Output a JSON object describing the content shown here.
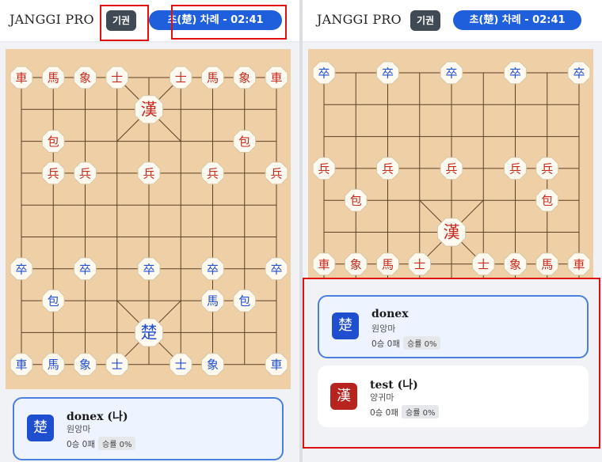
{
  "colors": {
    "board": "#efcfa5",
    "line": "#5c4026",
    "piece_fill": "#fffaf0",
    "cho_blue": "#1f4fcf",
    "han_red": "#c8281e",
    "turn_badge": "#1f5fdc",
    "highlight": "#e01010"
  },
  "header": {
    "title": "JANGGI PRO",
    "give_up_label": "기권",
    "turn_label": "초(楚) 차례 - 02:41"
  },
  "left_board": {
    "pieces": [
      {
        "ch": "車",
        "side": "red",
        "col": 0,
        "row": 0
      },
      {
        "ch": "馬",
        "side": "red",
        "col": 1,
        "row": 0
      },
      {
        "ch": "象",
        "side": "red",
        "col": 2,
        "row": 0
      },
      {
        "ch": "士",
        "side": "red",
        "col": 3,
        "row": 0
      },
      {
        "ch": "士",
        "side": "red",
        "col": 5,
        "row": 0
      },
      {
        "ch": "馬",
        "side": "red",
        "col": 6,
        "row": 0
      },
      {
        "ch": "象",
        "side": "red",
        "col": 7,
        "row": 0
      },
      {
        "ch": "車",
        "side": "red",
        "col": 8,
        "row": 0
      },
      {
        "ch": "漢",
        "side": "red",
        "col": 4,
        "row": 1,
        "king": true
      },
      {
        "ch": "包",
        "side": "red",
        "col": 1,
        "row": 2
      },
      {
        "ch": "包",
        "side": "red",
        "col": 7,
        "row": 2
      },
      {
        "ch": "兵",
        "side": "red",
        "col": 1,
        "row": 3
      },
      {
        "ch": "兵",
        "side": "red",
        "col": 2,
        "row": 3
      },
      {
        "ch": "兵",
        "side": "red",
        "col": 4,
        "row": 3
      },
      {
        "ch": "兵",
        "side": "red",
        "col": 6,
        "row": 3
      },
      {
        "ch": "兵",
        "side": "red",
        "col": 8,
        "row": 3
      },
      {
        "ch": "卒",
        "side": "blue",
        "col": 0,
        "row": 6
      },
      {
        "ch": "卒",
        "side": "blue",
        "col": 2,
        "row": 6
      },
      {
        "ch": "卒",
        "side": "blue",
        "col": 4,
        "row": 6
      },
      {
        "ch": "卒",
        "side": "blue",
        "col": 6,
        "row": 6
      },
      {
        "ch": "卒",
        "side": "blue",
        "col": 8,
        "row": 6
      },
      {
        "ch": "包",
        "side": "blue",
        "col": 1,
        "row": 7
      },
      {
        "ch": "馬",
        "side": "blue",
        "col": 6,
        "row": 7
      },
      {
        "ch": "包",
        "side": "blue",
        "col": 7,
        "row": 7
      },
      {
        "ch": "楚",
        "side": "blue",
        "col": 4,
        "row": 8,
        "king": true
      },
      {
        "ch": "車",
        "side": "blue",
        "col": 0,
        "row": 9
      },
      {
        "ch": "馬",
        "side": "blue",
        "col": 1,
        "row": 9
      },
      {
        "ch": "象",
        "side": "blue",
        "col": 2,
        "row": 9
      },
      {
        "ch": "士",
        "side": "blue",
        "col": 3,
        "row": 9
      },
      {
        "ch": "士",
        "side": "blue",
        "col": 5,
        "row": 9
      },
      {
        "ch": "象",
        "side": "blue",
        "col": 6,
        "row": 9
      },
      {
        "ch": "車",
        "side": "blue",
        "col": 8,
        "row": 9
      }
    ]
  },
  "right_board": {
    "pieces": [
      {
        "ch": "卒",
        "side": "blue",
        "col": 0,
        "row": 0
      },
      {
        "ch": "卒",
        "side": "blue",
        "col": 2,
        "row": 0
      },
      {
        "ch": "卒",
        "side": "blue",
        "col": 4,
        "row": 0
      },
      {
        "ch": "卒",
        "side": "blue",
        "col": 6,
        "row": 0
      },
      {
        "ch": "卒",
        "side": "blue",
        "col": 8,
        "row": 0
      },
      {
        "ch": "兵",
        "side": "red",
        "col": 0,
        "row": 3
      },
      {
        "ch": "兵",
        "side": "red",
        "col": 2,
        "row": 3
      },
      {
        "ch": "兵",
        "side": "red",
        "col": 4,
        "row": 3
      },
      {
        "ch": "兵",
        "side": "red",
        "col": 6,
        "row": 3
      },
      {
        "ch": "兵",
        "side": "red",
        "col": 7,
        "row": 3
      },
      {
        "ch": "包",
        "side": "red",
        "col": 1,
        "row": 4
      },
      {
        "ch": "包",
        "side": "red",
        "col": 7,
        "row": 4
      },
      {
        "ch": "漢",
        "side": "red",
        "col": 4,
        "row": 5,
        "king": true
      },
      {
        "ch": "車",
        "side": "red",
        "col": 0,
        "row": 6
      },
      {
        "ch": "象",
        "side": "red",
        "col": 1,
        "row": 6
      },
      {
        "ch": "馬",
        "side": "red",
        "col": 2,
        "row": 6
      },
      {
        "ch": "士",
        "side": "red",
        "col": 3,
        "row": 6
      },
      {
        "ch": "士",
        "side": "red",
        "col": 5,
        "row": 6
      },
      {
        "ch": "象",
        "side": "red",
        "col": 6,
        "row": 6
      },
      {
        "ch": "馬",
        "side": "red",
        "col": 7,
        "row": 6
      },
      {
        "ch": "車",
        "side": "red",
        "col": 8,
        "row": 6
      }
    ]
  },
  "players": {
    "me": {
      "badge": "楚",
      "name": "donex (나)",
      "setup": "원앙마",
      "record": "0승 0패",
      "rate": "승률 0%"
    },
    "right_top": {
      "badge": "楚",
      "name": "donex",
      "setup": "원앙마",
      "record": "0승 0패",
      "rate": "승률 0%"
    },
    "right_bottom": {
      "badge": "漢",
      "name": "test (나)",
      "setup": "양귀마",
      "record": "0승 0패",
      "rate": "승률 0%"
    }
  }
}
